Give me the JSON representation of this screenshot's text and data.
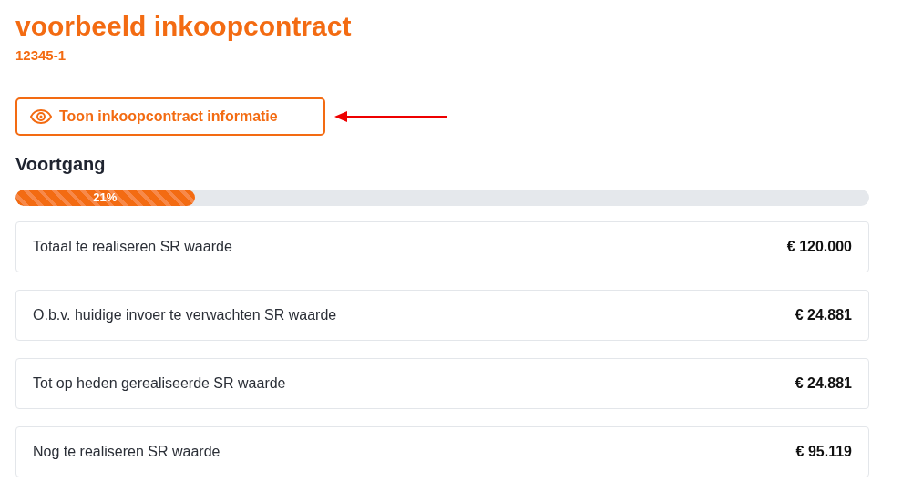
{
  "title": "voorbeeld inkoopcontract",
  "subtitle": "12345-1",
  "button": {
    "label": "Toon inkoopcontract informatie"
  },
  "progress": {
    "heading": "Voortgang",
    "level": 0.21,
    "reading": "21%"
  },
  "rows": [
    {
      "label": "Totaal te realiseren SR waarde",
      "value": "€ 120.000"
    },
    {
      "label": "O.b.v. huidige invoer te verwachten SR waarde",
      "value": "€ 24.881"
    },
    {
      "label": "Tot op heden gerealiseerde SR waarde",
      "value": "€ 24.881"
    },
    {
      "label": "Nog te realiseren SR waarde",
      "value": "€ 95.119"
    }
  ]
}
